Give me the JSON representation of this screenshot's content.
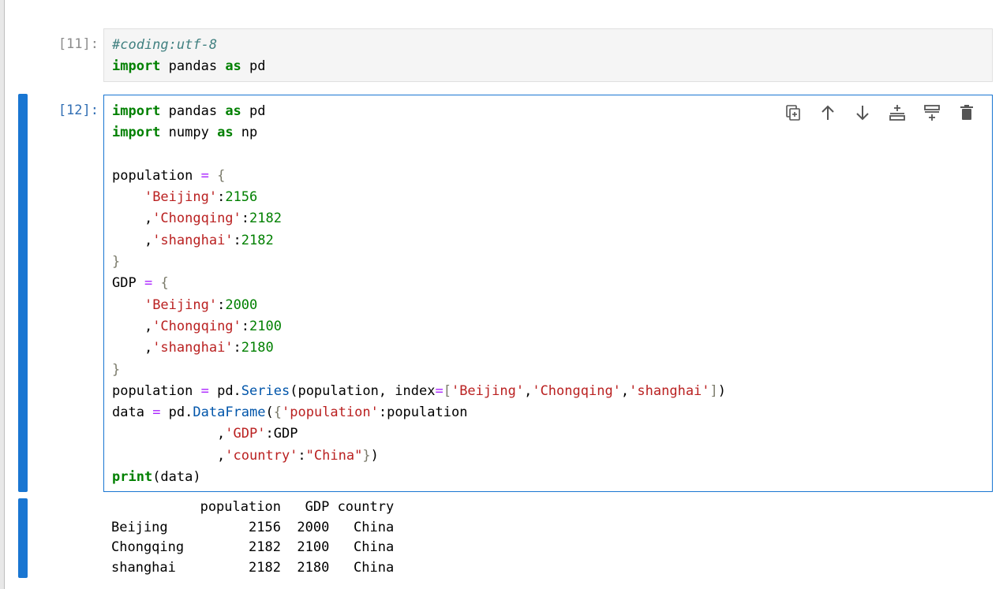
{
  "cells": [
    {
      "prompt": "[11]:",
      "code": [
        [
          [
            "cm",
            "#coding:utf-8"
          ]
        ],
        [
          [
            "kw",
            "import"
          ],
          [
            "",
            " pandas "
          ],
          [
            "kw",
            "as"
          ],
          [
            "",
            " pd"
          ]
        ]
      ]
    },
    {
      "prompt": "[12]:",
      "code": [
        [
          [
            "kw",
            "import"
          ],
          [
            "",
            " pandas "
          ],
          [
            "kw",
            "as"
          ],
          [
            "",
            " pd"
          ]
        ],
        [
          [
            "kw",
            "import"
          ],
          [
            "",
            " numpy "
          ],
          [
            "kw",
            "as"
          ],
          [
            "",
            " np"
          ]
        ],
        [],
        [
          [
            "",
            "population "
          ],
          [
            "op",
            "="
          ],
          [
            "",
            " "
          ],
          [
            "pn",
            "{"
          ]
        ],
        [
          [
            "",
            "    "
          ],
          [
            "st",
            "'Beijing'"
          ],
          [
            "",
            ":"
          ],
          [
            "nu",
            "2156"
          ]
        ],
        [
          [
            "",
            "    ,"
          ],
          [
            "st",
            "'Chongqing'"
          ],
          [
            "",
            ":"
          ],
          [
            "nu",
            "2182"
          ]
        ],
        [
          [
            "",
            "    ,"
          ],
          [
            "st",
            "'shanghai'"
          ],
          [
            "",
            ":"
          ],
          [
            "nu",
            "2182"
          ]
        ],
        [
          [
            "pn",
            "}"
          ]
        ],
        [
          [
            "",
            "GDP "
          ],
          [
            "op",
            "="
          ],
          [
            "",
            " "
          ],
          [
            "pn",
            "{"
          ]
        ],
        [
          [
            "",
            "    "
          ],
          [
            "st",
            "'Beijing'"
          ],
          [
            "",
            ":"
          ],
          [
            "nu",
            "2000"
          ]
        ],
        [
          [
            "",
            "    ,"
          ],
          [
            "st",
            "'Chongqing'"
          ],
          [
            "",
            ":"
          ],
          [
            "nu",
            "2100"
          ]
        ],
        [
          [
            "",
            "    ,"
          ],
          [
            "st",
            "'shanghai'"
          ],
          [
            "",
            ":"
          ],
          [
            "nu",
            "2180"
          ]
        ],
        [
          [
            "pn",
            "}"
          ]
        ],
        [
          [
            "",
            "population "
          ],
          [
            "op",
            "="
          ],
          [
            "",
            " pd."
          ],
          [
            "at",
            "Series"
          ],
          [
            "",
            "(population, index"
          ],
          [
            "op",
            "="
          ],
          [
            "pn",
            "["
          ],
          [
            "st",
            "'Beijing'"
          ],
          [
            "",
            ","
          ],
          [
            "st",
            "'Chongqing'"
          ],
          [
            "",
            ","
          ],
          [
            "st",
            "'shanghai'"
          ],
          [
            "pn",
            "]"
          ],
          [
            "",
            ")"
          ]
        ],
        [
          [
            "",
            "data "
          ],
          [
            "op",
            "="
          ],
          [
            "",
            " pd."
          ],
          [
            "at",
            "DataFrame"
          ],
          [
            "",
            "("
          ],
          [
            "pn",
            "{"
          ],
          [
            "st",
            "'population'"
          ],
          [
            "",
            ":population"
          ]
        ],
        [
          [
            "",
            "             ,"
          ],
          [
            "st",
            "'GDP'"
          ],
          [
            "",
            ":GDP"
          ]
        ],
        [
          [
            "",
            "             ,"
          ],
          [
            "st",
            "'country'"
          ],
          [
            "",
            ":"
          ],
          [
            "st",
            "\"China\""
          ],
          [
            "pn",
            "}"
          ],
          [
            "",
            ")"
          ]
        ],
        [
          [
            "kw",
            "print"
          ],
          [
            "",
            "(data)"
          ]
        ]
      ],
      "output": [
        "           population   GDP country",
        "Beijing          2156  2000   China",
        "Chongqing        2182  2100   China",
        "shanghai         2182  2180   China"
      ]
    }
  ],
  "toolbar": [
    {
      "name": "duplicate-cell-button",
      "icon": "copy-icon"
    },
    {
      "name": "move-up-button",
      "icon": "arrow-up-icon"
    },
    {
      "name": "move-down-button",
      "icon": "arrow-down-icon"
    },
    {
      "name": "insert-above-button",
      "icon": "insert-above-icon"
    },
    {
      "name": "insert-below-button",
      "icon": "insert-below-icon"
    },
    {
      "name": "delete-cell-button",
      "icon": "trash-icon"
    }
  ],
  "colors": {
    "accent": "#1976d2",
    "keyword": "#008000",
    "string": "#ba2121",
    "number": "#008000",
    "operator": "#aa22ff",
    "comment": "#408080"
  }
}
